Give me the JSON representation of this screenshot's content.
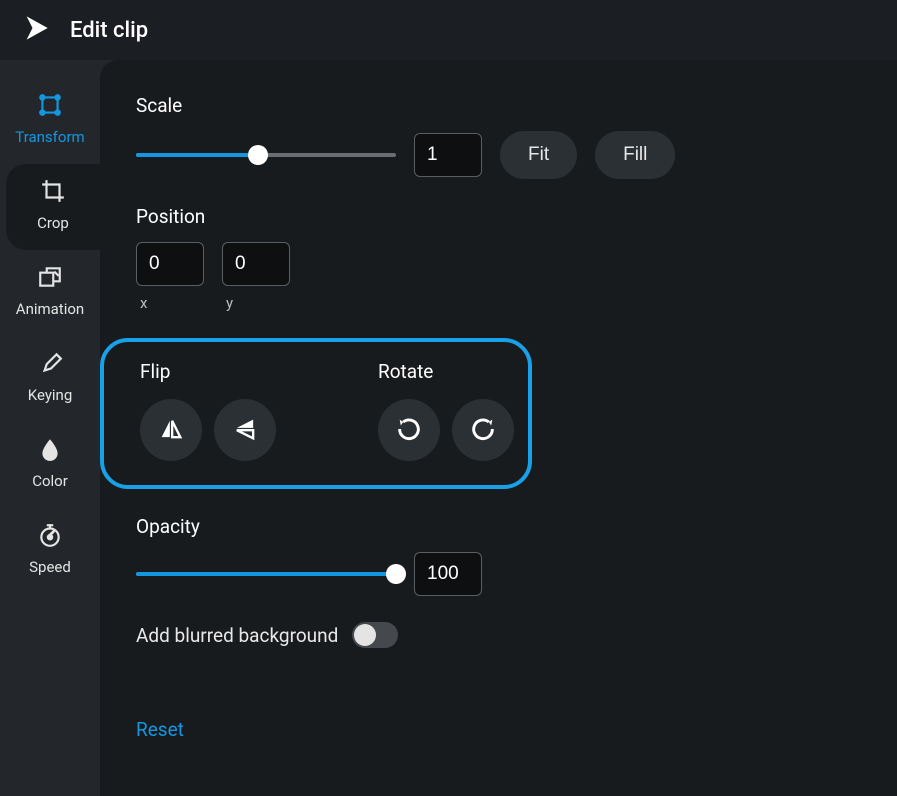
{
  "header": {
    "title": "Edit clip"
  },
  "sidebar": {
    "items": [
      {
        "label": "Transform"
      },
      {
        "label": "Crop"
      },
      {
        "label": "Animation"
      },
      {
        "label": "Keying"
      },
      {
        "label": "Color"
      },
      {
        "label": "Speed"
      }
    ]
  },
  "transform": {
    "scale": {
      "label": "Scale",
      "value": "1",
      "fill_percent": 47,
      "fit_label": "Fit",
      "fill_label": "Fill"
    },
    "position": {
      "label": "Position",
      "x_value": "0",
      "y_value": "0",
      "x_label": "x",
      "y_label": "y"
    },
    "flip": {
      "label": "Flip"
    },
    "rotate": {
      "label": "Rotate"
    },
    "opacity": {
      "label": "Opacity",
      "value": "100",
      "fill_percent": 100
    },
    "blurred_bg": {
      "label": "Add blurred background",
      "enabled": false
    },
    "reset_label": "Reset"
  },
  "colors": {
    "accent": "#1297e0",
    "highlight_border": "#18a0e8"
  }
}
